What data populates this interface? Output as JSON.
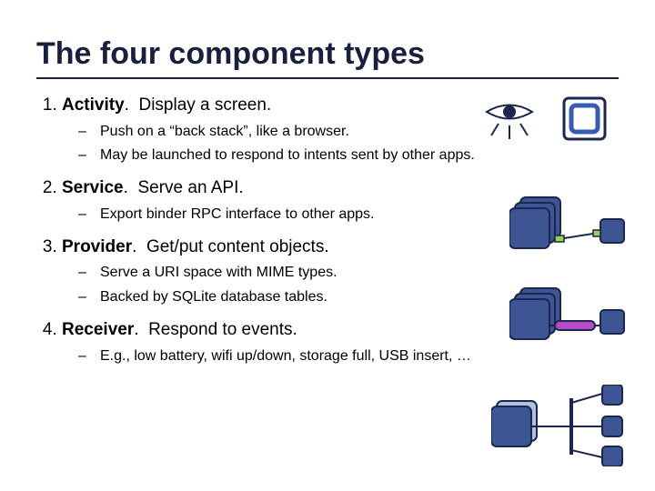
{
  "title": "The four component types",
  "items": [
    {
      "term": "Activity",
      "desc": "Display a screen.",
      "subs": [
        "Push on a “back stack”, like a browser.",
        "May be launched to respond to intents sent by other apps."
      ]
    },
    {
      "term": "Service",
      "desc": "Serve an API.",
      "subs": [
        "Export binder RPC interface to other apps."
      ]
    },
    {
      "term": "Provider",
      "desc": "Get/put content objects.",
      "subs": [
        "Serve a URI space with MIME types.",
        "Backed by SQLite database tables."
      ]
    },
    {
      "term": "Receiver",
      "desc": "Respond to events.",
      "subs": [
        "E.g., low battery, wifi up/down, storage full, USB insert, …"
      ]
    }
  ]
}
